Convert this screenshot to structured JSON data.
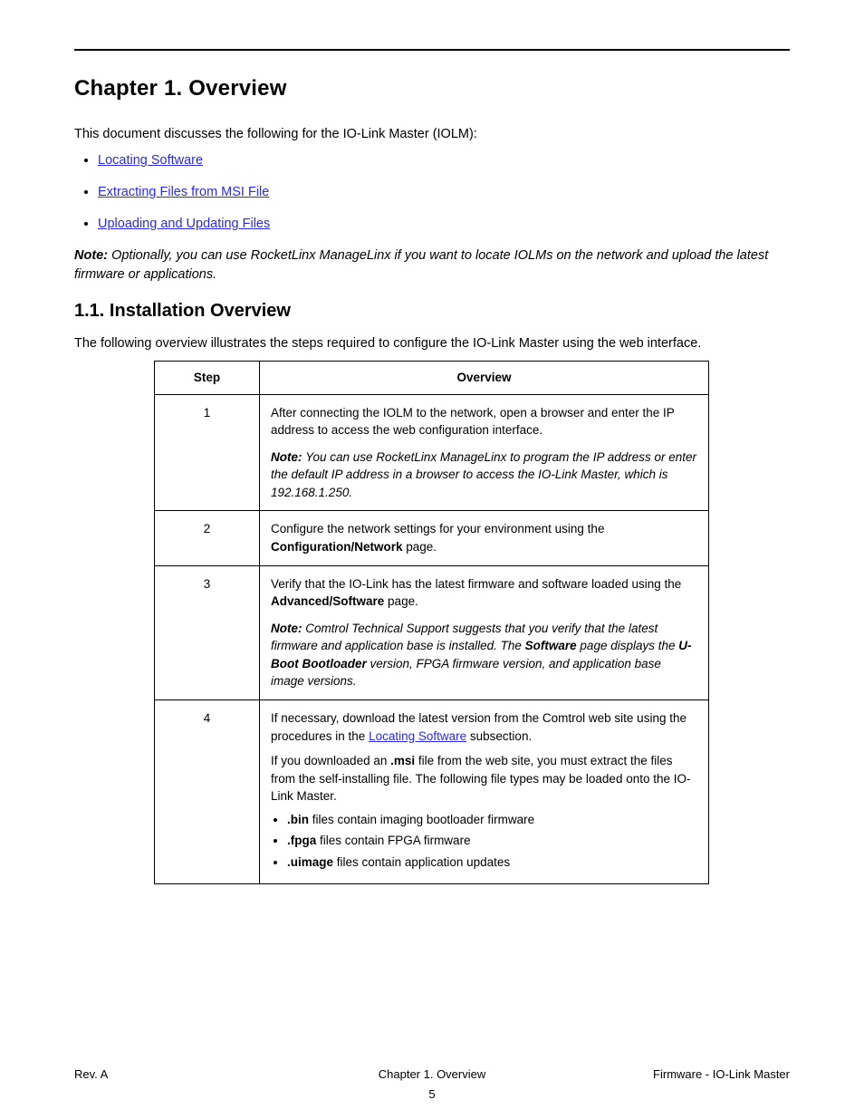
{
  "header": {
    "running_head": ""
  },
  "title": "Chapter 1. Overview",
  "intro": {
    "p1": "This document discusses the following for the IO-Link Master (IOLM):",
    "bullets": [
      {
        "label": "Locating Software",
        "href": "#locating"
      },
      {
        "label": "Extracting Files from MSI File",
        "href": "#extract"
      },
      {
        "label": "Uploading and Updating Files",
        "href": "#upload"
      }
    ],
    "note_label": "Note:",
    "note_text": " Optionally, you can use RocketLinx ManageLinx if you want to locate IOLMs on the network and upload the latest firmware or applications."
  },
  "section": {
    "heading": "1.1. Installation Overview",
    "lead": "The following overview illustrates the steps required to configure the IO-Link Master using the web interface.",
    "table": {
      "head_col1": "Step",
      "head_col2": "Overview",
      "rows": [
        {
          "step": "1",
          "main": "After connecting the IOLM to the network, open a browser and enter the IP address to access the web configuration interface.",
          "note": "You can use RocketLinx ManageLinx to program the IP address or enter the default IP address in a browser to access the IO-Link Master, which is 192.168.1.250."
        },
        {
          "step": "2",
          "main": "Configure the network settings for your environment using the ",
          "bold": "Configuration/Network",
          "tail": " page."
        },
        {
          "step": "3",
          "main": "Verify that the IO-Link has the latest firmware and software loaded using the ",
          "bold": "Advanced/Software",
          "tail": " page.",
          "note_lead": "Comtrol Technical Support suggests that you verify that the latest firmware and application base is installed. The ",
          "note_bold": "Software",
          "note_mid": " page displays the ",
          "note_bold2": "U-Boot Bootloader",
          "note_tail": " version, FPGA firmware version, and application base image versions."
        },
        {
          "step": "4",
          "main": "If necessary, download the latest version from the Comtrol web site using the procedures in the ",
          "link": "Locating Software",
          "tail": " subsection.",
          "note_intro": "If you downloaded an ",
          "note_file": ".msi",
          "note_after": " file from the web site, you must extract the files from the self-installing file. The following file types may be loaded onto the IO-Link Master.",
          "items": [
            {
              "ext": ".bin",
              "desc": "files contain imaging bootloader firmware"
            },
            {
              "ext": ".fpga",
              "desc": "files contain FPGA firmware"
            },
            {
              "ext": ".uimage",
              "desc": "files contain application updates"
            }
          ]
        }
      ]
    }
  },
  "footer": {
    "rev": "Rev. A",
    "title": "Firmware - IO-Link Master",
    "chapter": "Chapter 1. Overview",
    "page": "5"
  }
}
